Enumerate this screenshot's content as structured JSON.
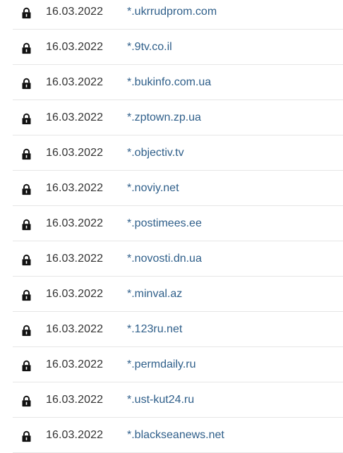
{
  "certificates": {
    "items": [
      {
        "date": "16.03.2022",
        "domain": "*.ukrrudprom.com"
      },
      {
        "date": "16.03.2022",
        "domain": "*.9tv.co.il"
      },
      {
        "date": "16.03.2022",
        "domain": "*.bukinfo.com.ua"
      },
      {
        "date": "16.03.2022",
        "domain": "*.zptown.zp.ua"
      },
      {
        "date": "16.03.2022",
        "domain": "*.objectiv.tv"
      },
      {
        "date": "16.03.2022",
        "domain": "*.noviy.net"
      },
      {
        "date": "16.03.2022",
        "domain": "*.postimees.ee"
      },
      {
        "date": "16.03.2022",
        "domain": "*.novosti.dn.ua"
      },
      {
        "date": "16.03.2022",
        "domain": "*.minval.az"
      },
      {
        "date": "16.03.2022",
        "domain": "*.123ru.net"
      },
      {
        "date": "16.03.2022",
        "domain": "*.permdaily.ru"
      },
      {
        "date": "16.03.2022",
        "domain": "*.ust-kut24.ru"
      },
      {
        "date": "16.03.2022",
        "domain": "*.blackseanews.net"
      }
    ],
    "icon": "lock-icon"
  },
  "colors": {
    "link": "#2f5f8a",
    "text": "#333333",
    "divider": "#e6e6e6"
  }
}
